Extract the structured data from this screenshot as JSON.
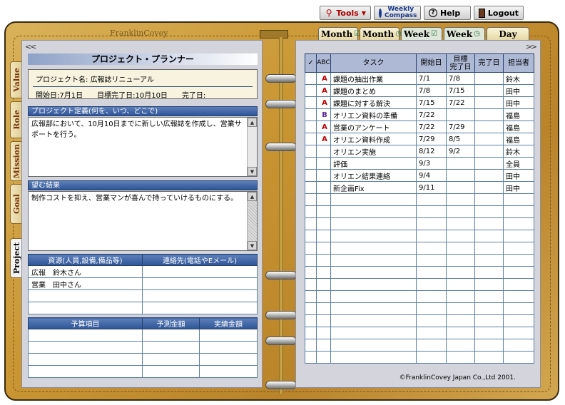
{
  "toolbar": {
    "tools": "Tools",
    "weekly_compass_1": "Weekly",
    "weekly_compass_2": "Compass",
    "help": "Help",
    "logout": "Logout"
  },
  "brand": "FranklinCovey",
  "top_tabs": [
    {
      "label": "Month",
      "glyph": "☑"
    },
    {
      "label": "Month",
      "glyph": "◷"
    },
    {
      "label": "Week",
      "glyph": "☑"
    },
    {
      "label": "Week",
      "glyph": "◷"
    },
    {
      "label": "Day",
      "glyph": ""
    }
  ],
  "side_tabs": [
    "Value",
    "Role",
    "Mission",
    "Goal",
    "Project"
  ],
  "left": {
    "title": "プロジェクト・プランナー",
    "project_name_label": "プロジェクト名:",
    "project_name": "広報誌リニューアル",
    "start_label": "開始日:",
    "start": "7月1日",
    "target_label": "目標完了日:",
    "target": "10月10日",
    "done_label": "完了日:",
    "done": "",
    "definition_head": "プロジェクト定義(何を、いつ、どこで)",
    "definition_text": "広報部において、10月10日までに新しい広報誌を作成し、営業サポートを行う。",
    "result_head": "望む結果",
    "result_text": "制作コストを抑え、営業マンが喜んで持っていけるものにする。",
    "resources": {
      "headers": [
        "資源(人員,設備,備品等)",
        "連絡先(電話やEメール)"
      ],
      "rows": [
        [
          "広報　鈴木さん",
          ""
        ],
        [
          "営業　田中さん",
          ""
        ],
        [
          "",
          ""
        ],
        [
          "",
          ""
        ]
      ]
    },
    "budget": {
      "headers": [
        "予算項目",
        "予測金額",
        "実績金額"
      ],
      "rows": [
        [
          "",
          "",
          ""
        ],
        [
          "",
          "",
          ""
        ],
        [
          "",
          "",
          ""
        ],
        [
          "",
          "",
          ""
        ]
      ]
    }
  },
  "right": {
    "headers": {
      "check": "✓",
      "abc": "ABC",
      "task": "タスク",
      "start": "開始日",
      "target1": "目標",
      "target2": "完了日",
      "done": "完了日",
      "owner": "担当者"
    },
    "rows": [
      {
        "pri": "A",
        "task": "課題の抽出作業",
        "start": "7/1",
        "target": "7/8",
        "done": "",
        "owner": "鈴木"
      },
      {
        "pri": "A",
        "task": "課題のまとめ",
        "start": "7/8",
        "target": "7/15",
        "done": "",
        "owner": "田中"
      },
      {
        "pri": "A",
        "task": "課題に対する解決",
        "start": "7/15",
        "target": "7/22",
        "done": "",
        "owner": "田中"
      },
      {
        "pri": "B",
        "task": "オリエン資料の準備",
        "start": "7/22",
        "target": "",
        "done": "",
        "owner": "福島"
      },
      {
        "pri": "A",
        "task": "営業のアンケート",
        "start": "7/22",
        "target": "7/29",
        "done": "",
        "owner": "福島"
      },
      {
        "pri": "A",
        "task": "オリエン資料作成",
        "start": "7/29",
        "target": "8/5",
        "done": "",
        "owner": "福島"
      },
      {
        "pri": "",
        "task": "オリエン実施",
        "start": "8/12",
        "target": "9/2",
        "done": "",
        "owner": "鈴木"
      },
      {
        "pri": "",
        "task": "評価",
        "start": "9/3",
        "target": "",
        "done": "",
        "owner": "全員"
      },
      {
        "pri": "",
        "task": "オリエン結果連絡",
        "start": "9/4",
        "target": "",
        "done": "",
        "owner": "田中"
      },
      {
        "pri": "",
        "task": "新企画Fix",
        "start": "9/11",
        "target": "",
        "done": "",
        "owner": "田中"
      }
    ],
    "empty_rows": 14
  },
  "copyright": "©FranklinCovey Japan Co.,Ltd 2001."
}
